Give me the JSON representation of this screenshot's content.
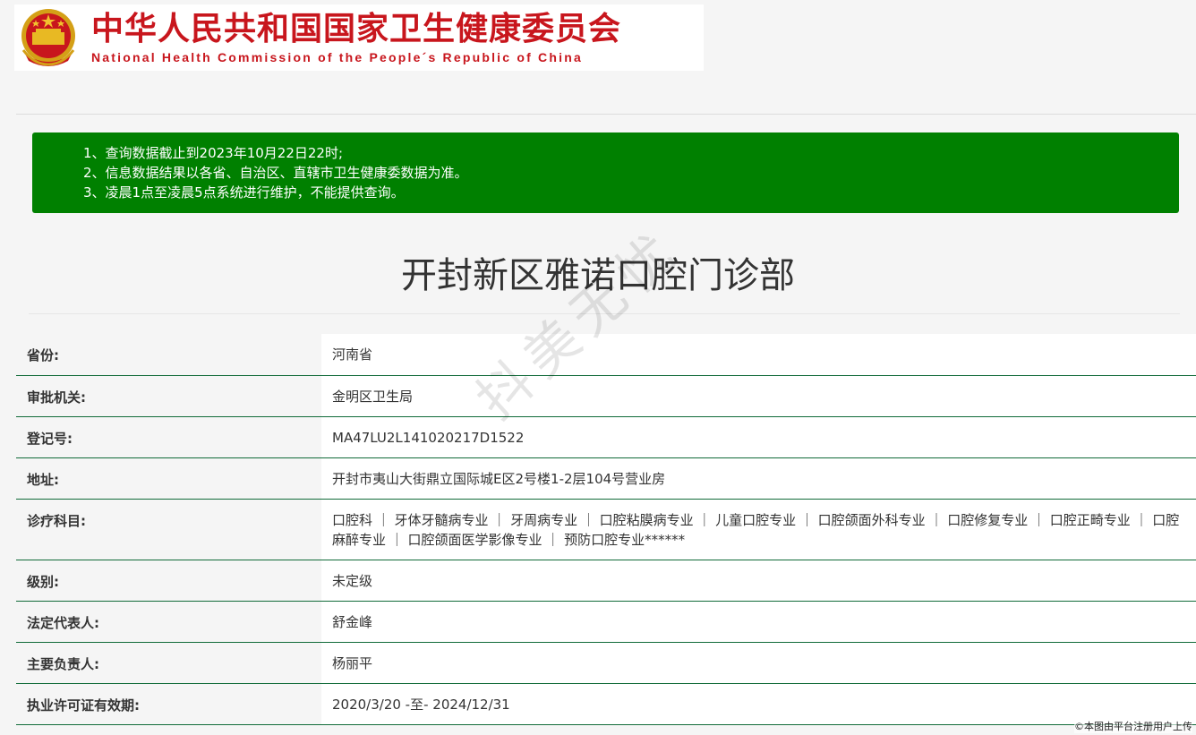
{
  "header": {
    "title_cn": "中华人民共和国国家卫生健康委员会",
    "title_en": "National Health Commission of the People´s Republic of China",
    "emblem_icon": "national-emblem-icon"
  },
  "notice": {
    "color": "#008000",
    "lines": [
      "1、查询数据截止到2023年10月22日22时;",
      "2、信息数据结果以各省、自治区、直辖市卫生健康委数据为准。",
      "3、凌晨1点至凌晨5点系统进行维护，不能提供查询。"
    ]
  },
  "page_title": "开封新区雅诺口腔门诊部",
  "watermark": "抖美无忧",
  "info": [
    {
      "label": "省份:",
      "value": "河南省"
    },
    {
      "label": "审批机关:",
      "value": "金明区卫生局"
    },
    {
      "label": "登记号:",
      "value": "MA47LU2L141020217D1522"
    },
    {
      "label": "地址:",
      "value": "开封市夷山大街鼎立国际城E区2号楼1-2层104号营业房"
    },
    {
      "label": "诊疗科目:",
      "value": "口腔科 ｜ 牙体牙髓病专业 ｜ 牙周病专业 ｜ 口腔粘膜病专业 ｜ 儿童口腔专业 ｜ 口腔颌面外科专业 ｜ 口腔修复专业 ｜ 口腔正畸专业 ｜ 口腔麻醉专业 ｜ 口腔颌面医学影像专业 ｜ 预防口腔专业******"
    },
    {
      "label": "级别:",
      "value": "未定级"
    },
    {
      "label": "法定代表人:",
      "value": "舒金峰"
    },
    {
      "label": "主要负责人:",
      "value": "杨丽平"
    },
    {
      "label": "执业许可证有效期:",
      "value": "2020/3/20 -至- 2024/12/31"
    }
  ],
  "footer": {
    "copyright": "©本图由平台注册用户上传"
  }
}
